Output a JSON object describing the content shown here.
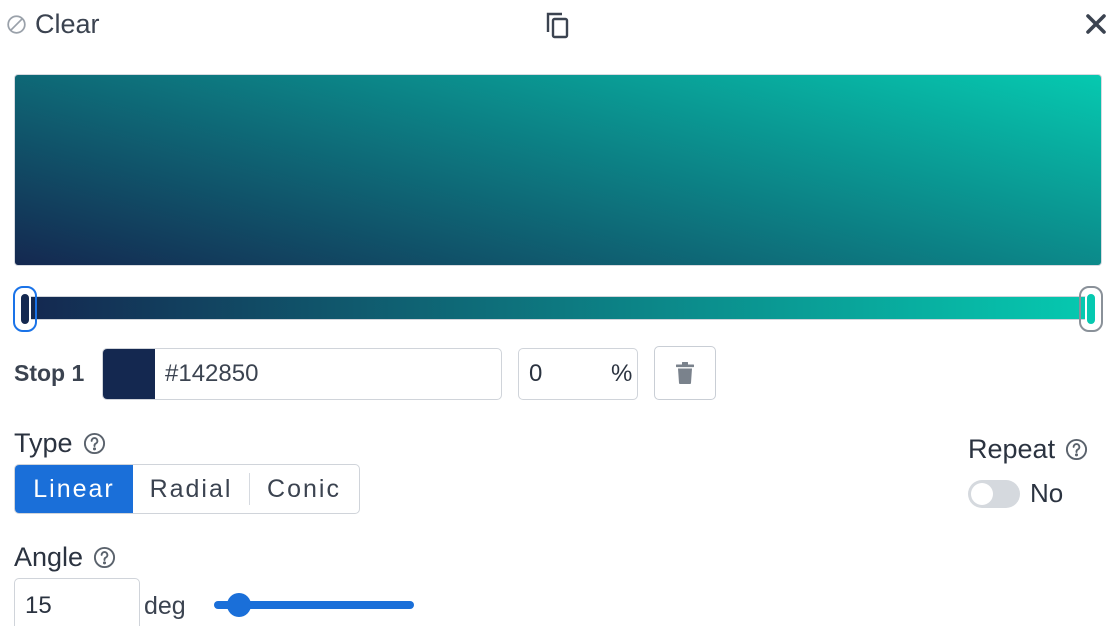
{
  "toolbar": {
    "clear_label": "Clear",
    "clear_icon": "ban-icon",
    "copy_icon": "copy-icon",
    "close_icon": "close-icon"
  },
  "gradient": {
    "stops": [
      {
        "color": "#142850",
        "position": 0
      },
      {
        "color": "#06c9b0",
        "position": 100
      }
    ]
  },
  "stop_editor": {
    "label": "Stop 1",
    "hex_value": "#142850",
    "position_value": "0",
    "position_unit": "%",
    "delete_icon": "trash-icon"
  },
  "type": {
    "label": "Type",
    "help_icon": "help-circle-icon",
    "options": [
      "Linear",
      "Radial",
      "Conic"
    ],
    "selected": "Linear"
  },
  "repeat": {
    "label": "Repeat",
    "help_icon": "help-circle-icon",
    "state_label": "No",
    "enabled": false
  },
  "angle": {
    "label": "Angle",
    "help_icon": "help-circle-icon",
    "value": "15",
    "unit": "deg",
    "max": 360
  },
  "colors": {
    "accent": "#1a6fd9",
    "border": "#d0d4da",
    "text": "#2b3340"
  }
}
